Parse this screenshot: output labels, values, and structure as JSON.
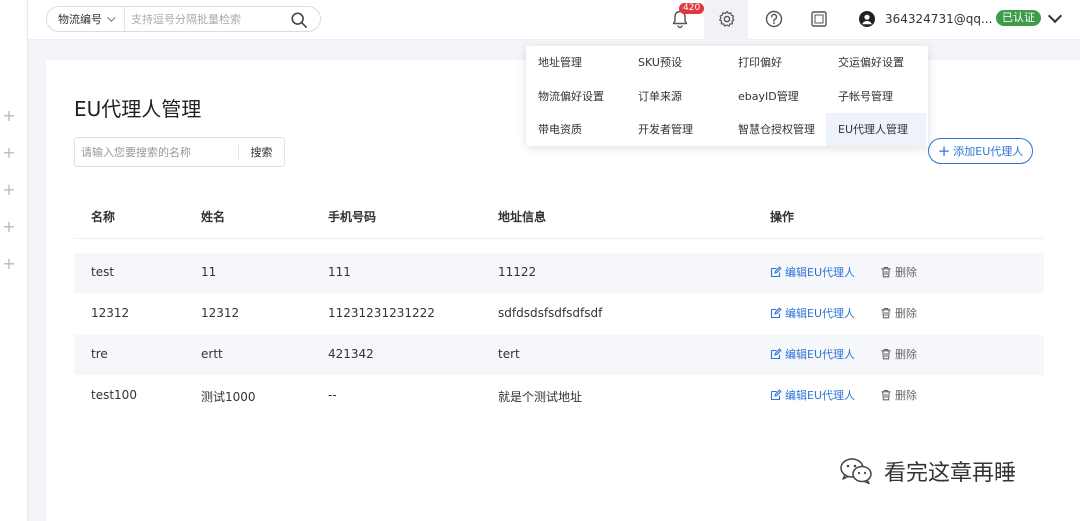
{
  "topbar": {
    "search_select": "物流编号",
    "search_placeholder": "支持逗号分隔批量检索",
    "notification_count": "420",
    "username": "364324731@qq...",
    "verified_label": "已认证"
  },
  "page": {
    "title": "EU代理人管理",
    "name_search_placeholder": "请输入您要搜索的名称",
    "search_button": "搜索",
    "add_button": "添加EU代理人"
  },
  "table": {
    "headers": [
      "名称",
      "姓名",
      "手机号码",
      "地址信息",
      "操作"
    ],
    "edit_label": "编辑EU代理人",
    "delete_label": "删除",
    "rows": [
      {
        "name": "test",
        "person": "11",
        "phone": "111",
        "address": "11122"
      },
      {
        "name": "12312",
        "person": "12312",
        "phone": "11231231231222",
        "address": "sdfdsdsfsdfsdfsdf"
      },
      {
        "name": "tre",
        "person": "ertt",
        "phone": "421342",
        "address": "tert"
      },
      {
        "name": "test100",
        "person": "测试1000",
        "phone": "--",
        "address": "就是个测试地址"
      }
    ]
  },
  "menu": {
    "items": [
      "地址管理",
      "SKU预设",
      "打印偏好",
      "交运偏好设置",
      "物流偏好设置",
      "订单来源",
      "ebayID管理",
      "子帐号管理",
      "带电资质",
      "开发者管理",
      "智慧仓授权管理",
      "EU代理人管理"
    ],
    "active_index": 11
  },
  "watermark": {
    "text": "看完这章再睡"
  },
  "colors": {
    "accent": "#2e73d6",
    "verified": "#3e9c4b",
    "badge": "#e0383e"
  }
}
